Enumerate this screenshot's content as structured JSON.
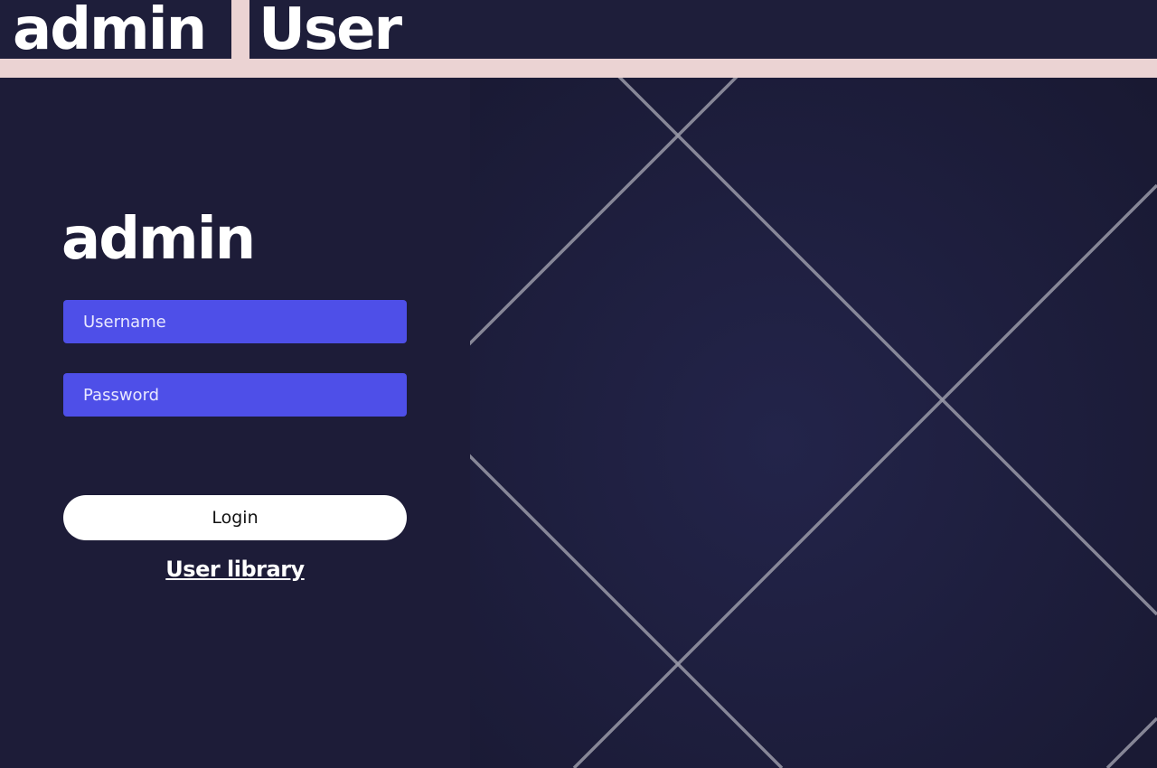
{
  "header": {
    "tabs": [
      {
        "label": "admin"
      },
      {
        "label": "User"
      }
    ]
  },
  "login": {
    "title": "admin",
    "username_placeholder": "Username",
    "password_placeholder": "Password",
    "submit_label": "Login",
    "library_link": "User library"
  },
  "colors": {
    "background": "#1e1e3a",
    "accent_strip": "#ebd3d3",
    "input_fill": "#4e4fe8",
    "button_fill": "#ffffff"
  }
}
